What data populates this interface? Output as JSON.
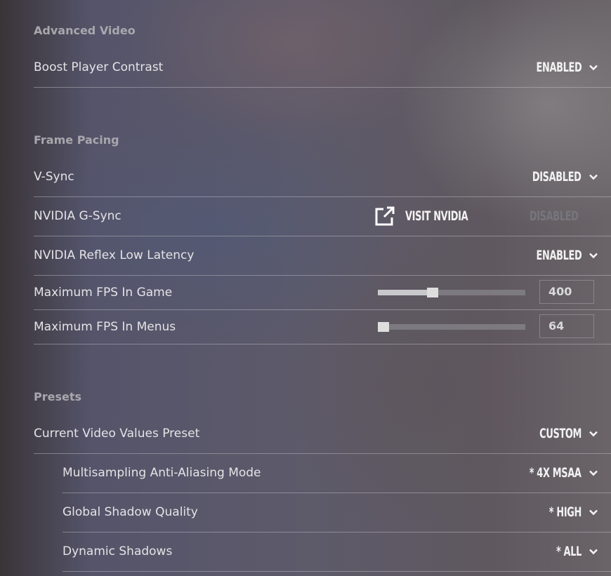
{
  "sections": [
    {
      "title": "Advanced Video"
    },
    {
      "title": "Frame Pacing"
    },
    {
      "title": "Presets"
    }
  ],
  "rows": [
    {
      "label": "Boost Player Contrast",
      "value": "ENABLED"
    },
    {
      "label": "V-Sync",
      "value": "DISABLED"
    },
    {
      "label": "NVIDIA G-Sync",
      "value": "DISABLED",
      "link": "VISIT NVIDIA",
      "link_icon": "external-link-icon"
    },
    {
      "label": "NVIDIA Reflex Low Latency",
      "value": "ENABLED"
    },
    {
      "label": "Maximum FPS In Game",
      "value": "400",
      "slider_fraction": 0.37
    },
    {
      "label": "Maximum FPS In Menus",
      "value": "64",
      "slider_fraction": 0.0
    },
    {
      "label": "Current Video Values Preset",
      "value": "CUSTOM"
    },
    {
      "label": "Multisampling Anti-Aliasing Mode",
      "value": "* 4X MSAA"
    },
    {
      "label": "Global Shadow Quality",
      "value": "* HIGH"
    },
    {
      "label": "Dynamic Shadows",
      "value": "* ALL"
    }
  ],
  "colors": {
    "text": "#e4e3e6",
    "header": "#a9a7ad",
    "disabled": "#77767d"
  }
}
